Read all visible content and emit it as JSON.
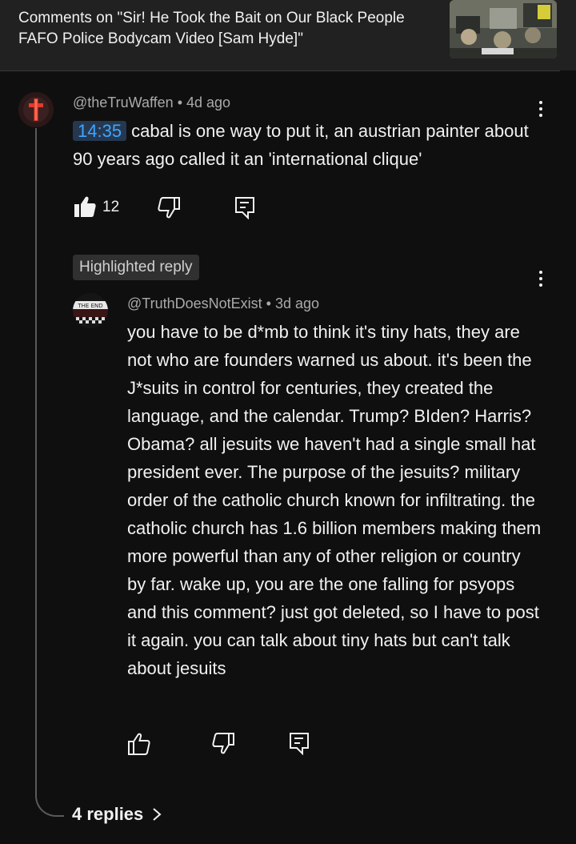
{
  "header": {
    "title": "Comments on \"Sir! He Took the Bait on Our Black People FAFO Police Bodycam Video [Sam Hyde]\""
  },
  "comment": {
    "author": "@theTruWaffen",
    "time": "4d ago",
    "timestamp_link": "14:35",
    "text": " cabal is one way to put it, an austrian painter about 90 years ago called it an 'international clique'",
    "likes": "12"
  },
  "highlight_chip": "Highlighted reply",
  "reply": {
    "author": "@TruthDoesNotExist",
    "time": "3d ago",
    "text": "you have to be d*mb to think it's tiny hats, they are not who are founders warned us about. it's been the J*suits in control for centuries, they created the language, and the calendar. Trump? BIden? Harris? Obama?  all jesuits we haven't had a single small hat president ever. The purpose of the jesuits? military order of the catholic church known for infiltrating.  the catholic church has 1.6 billion members making them more powerful than any of other religion or country by far. wake up, you are the one falling for psyops and this comment? just got deleted, so I have to post it again. you can talk about tiny hats but can't talk about jesuits",
    "avatar_text": "THE END"
  },
  "replies_link": {
    "label": "4 replies"
  },
  "colors": {
    "background": "#0f0f0f",
    "header": "#212121",
    "timestamp_link": "#3ea6ff",
    "meta_text": "#aaaaaa",
    "chip_bg": "#303030"
  },
  "icons": {
    "like_filled": "thumbs-up-filled-icon",
    "like": "thumbs-up-icon",
    "dislike": "thumbs-down-icon",
    "reply": "reply-icon",
    "more": "more-vert-icon",
    "chevron": "chevron-right-icon"
  }
}
